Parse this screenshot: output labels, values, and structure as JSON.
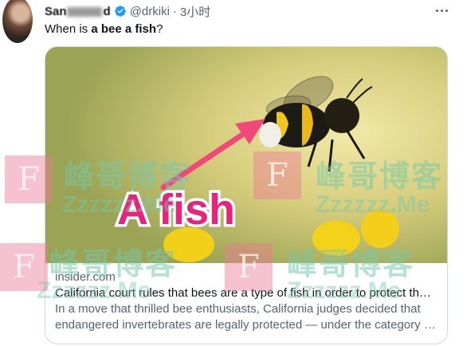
{
  "tweet": {
    "author_name": "San",
    "author_name_tail": "d",
    "handle": "@drkiki",
    "separator": "·",
    "time": "3小时",
    "text_prefix": "When is ",
    "text_bold": "a bee a fish",
    "text_suffix": "?"
  },
  "card": {
    "image_overlay_text": "A fish",
    "domain": "insider.com",
    "title": "California court rules that bees are a type of fish in order to protect th…",
    "description": "In a move that thrilled bee enthusiasts, California judges decided that endangered invertebrates are legally protected — under the category …"
  },
  "watermark": {
    "letter": "F",
    "cn": "峰哥博客",
    "en": "Zzzzzz.Me"
  },
  "colors": {
    "verified": "#1d9bf0",
    "arrow": "#f0487a",
    "overlay_text_fill": "#e8237a",
    "overlay_text_stroke": "#ffffff"
  },
  "icons": [
    "verified-badge-icon",
    "more-options-icon"
  ]
}
